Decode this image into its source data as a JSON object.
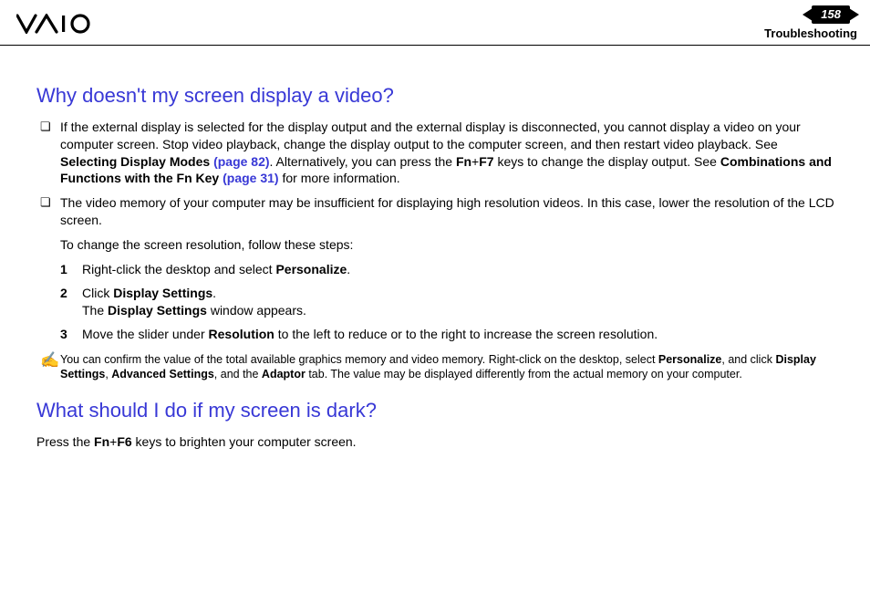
{
  "header": {
    "page_number": "158",
    "section": "Troubleshooting"
  },
  "q1": {
    "title": "Why doesn't my screen display a video?",
    "b1_pre": "If the external display is selected for the display output and the external display is disconnected, you cannot display a video on your computer screen. Stop video playback, change the display output to the computer screen, and then restart video playback. See ",
    "b1_bold1": "Selecting Display Modes ",
    "b1_link1": "(page 82)",
    "b1_mid": ". Alternatively, you can press the ",
    "b1_bold2": "Fn",
    "b1_plus": "+",
    "b1_bold3": "F7",
    "b1_mid2": " keys to change the display output. See ",
    "b1_bold4": "Combinations and Functions with the Fn Key ",
    "b1_link2": "(page 31)",
    "b1_post": " for more information.",
    "b2": "The video memory of your computer may be insufficient for displaying high resolution videos. In this case, lower the resolution of the LCD screen.",
    "intro_steps": "To change the screen resolution, follow these steps:",
    "s1_pre": "Right-click the desktop and select ",
    "s1_b": "Personalize",
    "s1_post": ".",
    "s2_pre": "Click ",
    "s2_b1": "Display Settings",
    "s2_mid": ".",
    "s2_line2_pre": "The ",
    "s2_line2_b": "Display Settings",
    "s2_line2_post": " window appears.",
    "s3_pre": "Move the slider under ",
    "s3_b": "Resolution",
    "s3_post": " to the left to reduce or to the right to increase the screen resolution.",
    "note_pre": "You can confirm the value of the total available graphics memory and video memory. Right-click on the desktop, select ",
    "note_b1": "Personalize",
    "note_m1": ", and click ",
    "note_b2": "Display Settings",
    "note_m2": ", ",
    "note_b3": "Advanced Settings",
    "note_m3": ", and the ",
    "note_b4": "Adaptor",
    "note_post": " tab. The value may be displayed differently from the actual memory on your computer."
  },
  "q2": {
    "title": "What should I do if my screen is dark?",
    "p_pre": "Press the ",
    "p_b1": "Fn",
    "p_plus": "+",
    "p_b2": "F6",
    "p_post": " keys to brighten your computer screen."
  },
  "marks": {
    "square": "❏",
    "pencil": "✍",
    "n1": "1",
    "n2": "2",
    "n3": "3"
  }
}
